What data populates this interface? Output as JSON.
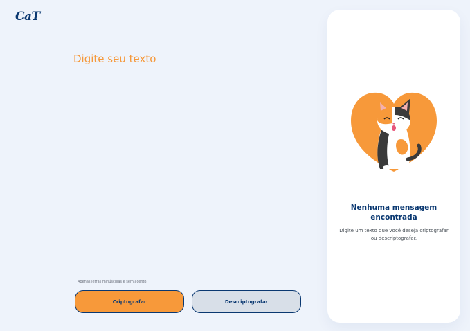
{
  "brand": {
    "logo_text": "CaT"
  },
  "input": {
    "placeholder": "Digite seu texto",
    "value": ""
  },
  "hint": {
    "text": "Apenas letras minúsculas e sem acento."
  },
  "buttons": {
    "encrypt_label": "Criptografar",
    "decrypt_label": "Descriptografar"
  },
  "output_panel": {
    "title": "Nenhuma mensagem encontrada",
    "description": "Digite um texto que você deseja criptografar ou descriptografar."
  },
  "colors": {
    "background": "#eef3fb",
    "accent_orange": "#f7993a",
    "primary_navy": "#0a3871",
    "secondary_button": "#d8dfe8",
    "panel": "#ffffff"
  },
  "icons": {
    "illustration": "calico-cat-heart-illustration",
    "hint": "warning-icon"
  }
}
